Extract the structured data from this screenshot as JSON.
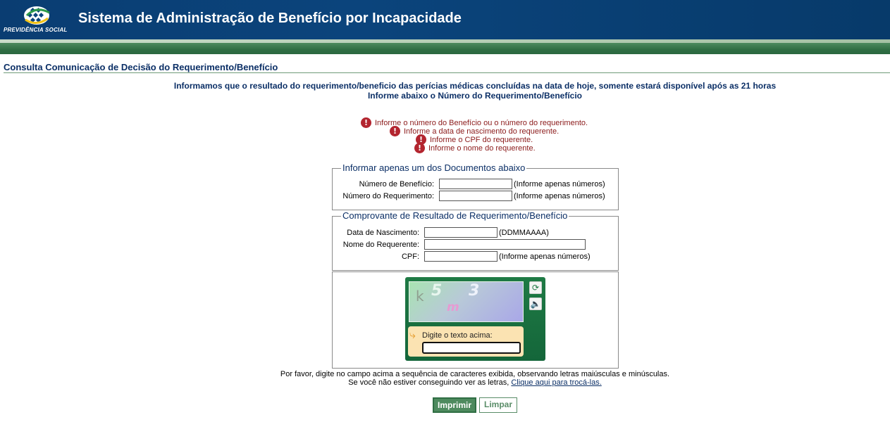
{
  "header": {
    "logo_text": "PREVIDÊNCIA SOCIAL",
    "title": "Sistema de Administração de Benefício por Incapacidade"
  },
  "page": {
    "title": "Consulta Comunicação de Decisão do Requerimento/Benefício",
    "info_line1": "Informamos que o resultado do requerimento/beneficio das perícias médicas concluídas na data de hoje, somente estará disponível após as 21 horas",
    "info_line2": "Informe abaixo o Número do Requerimento/Benefício"
  },
  "errors": [
    "Informe o número do Benefício ou o número do requerimento.",
    "Informe a data de nascimento do requerente.",
    "Informe o CPF do requerente.",
    "Informe o nome do requerente."
  ],
  "documents": {
    "legend": "Informar apenas um dos Documentos abaixo",
    "beneficio_label": "Número de Benefício:",
    "beneficio_hint": "(Informe apenas números)",
    "beneficio_value": "",
    "requerimento_label": "Número do Requerimento:",
    "requerimento_hint": "(Informe apenas números)",
    "requerimento_value": ""
  },
  "comprovante": {
    "legend": "Comprovante de Resultado de Requerimento/Benefício",
    "nascimento_label": "Data de Nascimento:",
    "nascimento_hint": "(DDMMAAAA)",
    "nascimento_value": "",
    "nome_label": "Nome do Requerente:",
    "nome_value": "",
    "cpf_label": "CPF:",
    "cpf_hint": "(Informe apenas números)",
    "cpf_value": ""
  },
  "captcha": {
    "chars": [
      "k",
      "5",
      "3",
      "m"
    ],
    "prompt": "Digite o texto acima:",
    "value": "",
    "refresh_icon": "refresh-icon",
    "audio_icon": "speaker-icon"
  },
  "notes": {
    "line1": "Por favor, digite no campo acima a sequência de caracteres exibida, observando letras maiúsculas e minúsculas.",
    "line2_prefix": "Se você não estiver conseguindo ver as letras,",
    "line2_link": "Clique aqui para trocá-las."
  },
  "buttons": {
    "print": "Imprimir",
    "clear": "Limpar"
  },
  "colors": {
    "header_blue": "#0b447c",
    "band_green": "#2f6e43",
    "title_blue": "#0b2f66",
    "error_red": "#8b1a1a"
  }
}
